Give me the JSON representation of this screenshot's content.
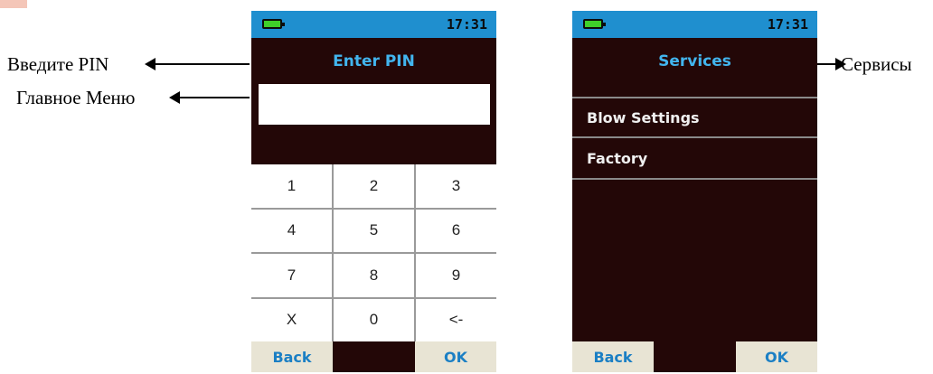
{
  "annotations": {
    "enter_pin": "Введите PIN",
    "main_menu": "Главное Меню",
    "services": "Сервисы"
  },
  "screen_pin": {
    "time": "17:31",
    "title": "Enter PIN",
    "pin_value": "",
    "keys": [
      "1",
      "2",
      "3",
      "4",
      "5",
      "6",
      "7",
      "8",
      "9",
      "X",
      "0",
      "<-"
    ],
    "soft_left": "Back",
    "soft_right": "OK"
  },
  "screen_services": {
    "time": "17:31",
    "title": "Services",
    "menu_items": [
      "Blow Settings",
      "Factory"
    ],
    "soft_left": "Back",
    "soft_right": "OK"
  },
  "colors": {
    "status_bar": "#1f8fcf",
    "screen_bg": "#230707",
    "title": "#42b5ee",
    "softkey_bg": "#e8e4d4",
    "softkey_text": "#1b7fc4",
    "battery": "#3fd02a"
  },
  "icons": {
    "battery": "battery-icon",
    "arrow": "arrow-icon"
  }
}
